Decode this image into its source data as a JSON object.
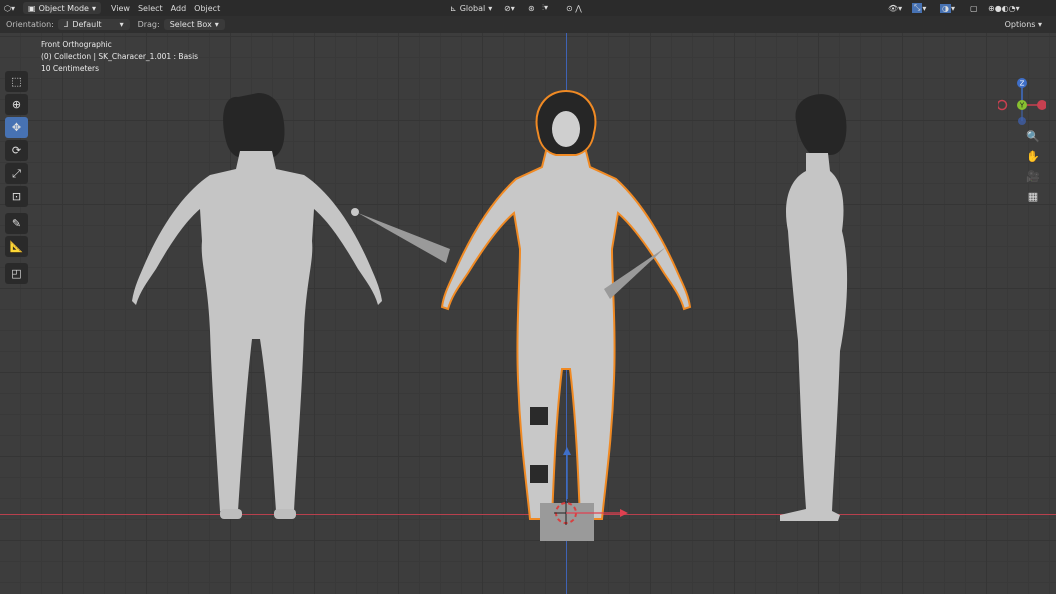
{
  "header": {
    "mode_label": "Object Mode",
    "menus": [
      "View",
      "Select",
      "Add",
      "Object"
    ],
    "transform_orientation": "Global",
    "mode_icon": "cube-icon",
    "editor_icon": "3d-view-icon"
  },
  "tool_options": {
    "orientation_label": "Orientation:",
    "orientation_value": "Default",
    "drag_label": "Drag:",
    "drag_value": "Select Box",
    "options_label": "Options"
  },
  "viewport": {
    "view_name": "Front Orthographic",
    "collection_info": "(0) Collection | SK_Characer_1.001 : Basis",
    "grid_scale": "10 Centimeters"
  },
  "gizmo": {
    "z_label": "Z",
    "y_label": "Y"
  },
  "toolbar": {
    "tools": [
      "select-box-icon",
      "cursor-icon",
      "move-icon",
      "rotate-icon",
      "scale-icon",
      "transform-icon",
      "annotate-icon",
      "measure-icon",
      "add-cube-icon"
    ]
  },
  "colors": {
    "background": "#3d3d3d",
    "header": "#2b2b2b",
    "active_tool": "#4772b3",
    "x_axis": "#b8404d",
    "z_axis": "#3f63b5",
    "selection_outline": "#f08a24"
  }
}
